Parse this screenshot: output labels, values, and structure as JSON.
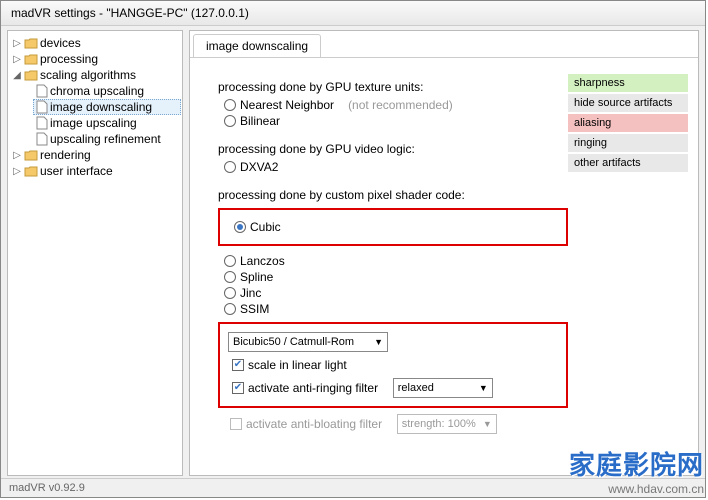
{
  "window_title": "madVR settings - \"HANGGE-PC\" (127.0.0.1)",
  "status": "madVR v0.92.9",
  "tree": {
    "devices": "devices",
    "processing": "processing",
    "scaling": "scaling algorithms",
    "chroma": "chroma upscaling",
    "img_down": "image downscaling",
    "img_up": "image upscaling",
    "upscale_ref": "upscaling refinement",
    "rendering": "rendering",
    "ui": "user interface"
  },
  "tab": {
    "active": "image downscaling"
  },
  "sections": {
    "s1": "processing done by GPU texture units:",
    "s2": "processing done by GPU video logic:",
    "s3": "processing done by custom pixel shader code:"
  },
  "radios": {
    "nn": "Nearest Neighbor",
    "nn_note": "(not recommended)",
    "bilinear": "Bilinear",
    "dxva2": "DXVA2",
    "cubic": "Cubic",
    "lanczos": "Lanczos",
    "spline": "Spline",
    "jinc": "Jinc",
    "ssim": "SSIM"
  },
  "dd": {
    "variant": "Bicubic50 / Catmull-Rom",
    "relaxed": "relaxed",
    "strength": "strength: 100%"
  },
  "checks": {
    "linear": "scale in linear light",
    "antiring": "activate anti-ringing filter",
    "antibloat": "activate anti-bloating filter"
  },
  "side": {
    "sharp": "sharpness",
    "hide": "hide source artifacts",
    "alias": "aliasing",
    "ring": "ringing",
    "other": "other artifacts"
  },
  "watermark": {
    "cn": "家庭影院网",
    "url": "www.hdav.com.cn"
  }
}
